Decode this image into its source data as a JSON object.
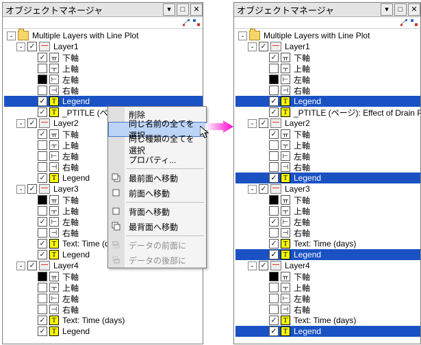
{
  "title": "オブジェクトマネージャ",
  "root": "Multiple Layers with Line Plot",
  "layer1": {
    "name": "Layer1",
    "axis_bottom": "下軸",
    "axis_top": "上軸",
    "axis_left": "左軸",
    "axis_right": "右軸",
    "legend": "Legend",
    "ptitle_left": "_PTITLE (ペー",
    "ptitle_right": "_PTITLE (ページ): Effect of Drain Para"
  },
  "layer2": {
    "name": "Layer2",
    "axis_bottom": "下軸",
    "axis_top": "上軸",
    "axis_left": "左軸",
    "axis_right": "右軸",
    "legend": "Legend"
  },
  "layer3": {
    "name": "Layer3",
    "axis_bottom": "下軸",
    "axis_top": "上軸",
    "axis_left": "左軸",
    "axis_right": "右軸",
    "text": "Text: Time (days)",
    "legend": "Legend"
  },
  "layer4": {
    "name": "Layer4",
    "axis_bottom": "下軸",
    "axis_top": "上軸",
    "axis_left": "左軸",
    "axis_right": "右軸",
    "text": "Text: Time (days)",
    "legend": "Legend"
  },
  "ctx": {
    "delete": "削除",
    "select_same_name": "同じ名前の全てを選択",
    "select_same_type": "同じ種類の全てを選択",
    "properties": "プロパティ...",
    "to_front": "最前面へ移動",
    "forward": "前面へ移動",
    "backward": "背面へ移動",
    "to_back": "最背面へ移動",
    "push_front": "データの前面に",
    "push_back": "データの後部に"
  },
  "titlebar": {
    "pin": "▾",
    "close": "✕",
    "minus": "-",
    "t": "T"
  }
}
